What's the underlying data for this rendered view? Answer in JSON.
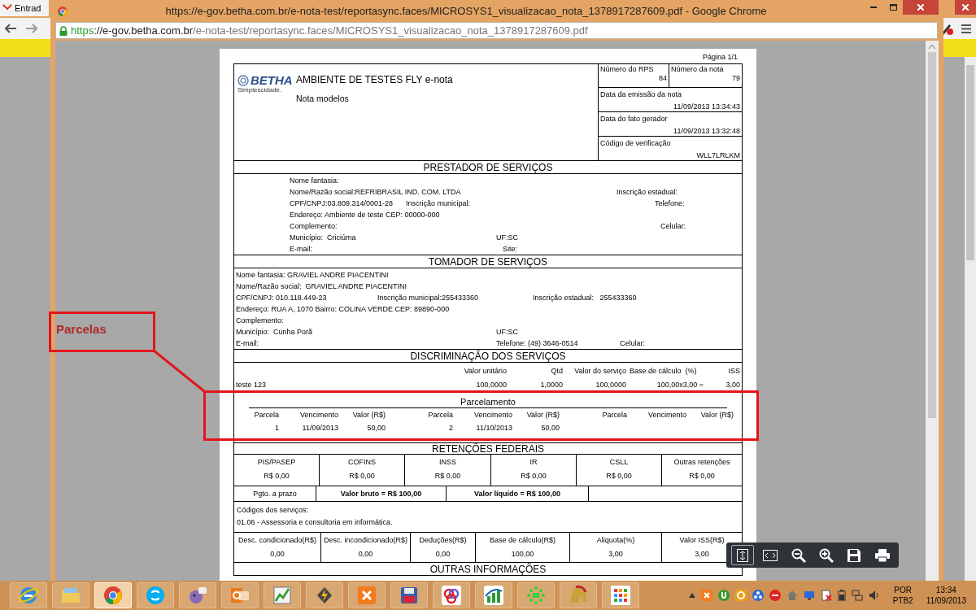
{
  "background_window": {
    "tab_title": "Entrad"
  },
  "window": {
    "title": "https://e-gov.betha.com.br/e-nota-test/reportasync.faces/MICROSYS1_visualizacao_nota_1378917287609.pdf - Google Chrome"
  },
  "address_bar": {
    "scheme": "https",
    "host": "://e-gov.betha.com.br",
    "path": "/e-nota-test/reportasync.faces/MICROSYS1_visualizacao_nota_1378917287609.pdf"
  },
  "document": {
    "page_label": "Página 1/1",
    "logo": {
      "brand": "BETHA",
      "tagline": "Simplescidade."
    },
    "title": "AMBIENTE DE TESTES FLY e-nota",
    "subtitle": "Nota modelos",
    "info": [
      {
        "label": "Número do RPS",
        "value": "84"
      },
      {
        "label": "Número da nota",
        "value": "79"
      },
      {
        "label": "Data da emissão da nota",
        "value": "11/09/2013 13:34:43"
      },
      {
        "label": "Data do fato gerador",
        "value": "11/09/2013 13:32:48"
      },
      {
        "label": "Código de verificação",
        "value": "WLL7LRLKM"
      }
    ],
    "sections": [
      {
        "title": "PRESTADOR DE SERVIÇOS",
        "rows": [
          [
            "Nome fantasia:"
          ],
          [
            "Nome/Razão social:REFRIBRASIL IND. COM. LTDA",
            "Inscrição estadual:"
          ],
          [
            "CPF/CNPJ:03.809.314/0001-28",
            "Inscrição municipal:",
            "Telefone:"
          ],
          [
            "Endereço: Ambiente de teste CEP: 00000-000"
          ],
          [
            "Complemento:",
            "Celular:"
          ],
          [
            "Município:  Criciúma",
            "UF:SC"
          ],
          [
            "E-mail:",
            "Site:"
          ]
        ]
      },
      {
        "title": "TOMADOR DE SERVIÇOS",
        "rows": [
          [
            "Nome fantasia: GRAVIEL ANDRE PIACENTINI"
          ],
          [
            "Nome/Razão social:  GRAVIEL ANDRE PIACENTINI"
          ],
          [
            "CPF/CNPJ: 010.118.449-23",
            "Inscrição municipal:255433360",
            "Inscrição estadual:   255433360"
          ],
          [
            "Endereço: RUA A, 1070 Bairro: COLINA VERDE CEP: 89890-000"
          ],
          [
            "Complemento:"
          ],
          [
            "Município:  Cunha Porã",
            "UF:SC"
          ],
          [
            "E-mail:",
            "Telefone: (49) 3646-0514",
            "Celular:"
          ]
        ]
      }
    ],
    "services": {
      "title": "DISCRIMINAÇÃO DOS SERVIÇOS",
      "columns": [
        "Valor unitário",
        "Qtd",
        "Valor do serviço",
        "Base de cálculo  (%)",
        "ISS"
      ],
      "rows": [
        {
          "description": "teste 123",
          "cells": [
            "100,0000",
            "1,0000",
            "100,0000",
            "100,00x3,00 =",
            "3,00"
          ]
        }
      ]
    },
    "installments": {
      "title": "Parcelamento",
      "groups": [
        [
          "Parcela",
          "Vencimento",
          "Valor (R$)"
        ],
        [
          "Parcela",
          "Vencimento",
          "Valor (R$)"
        ],
        [
          "Parcela",
          "Vencimento",
          "Valor (R$)"
        ]
      ],
      "entries": [
        [
          "1",
          "11/09/2013",
          "50,00"
        ],
        [
          "2",
          "11/10/2013",
          "50,00"
        ]
      ]
    },
    "federal_withholdings": {
      "title": "RETENÇÕES FEDERAIS",
      "items": [
        {
          "label": "PIS/PASEP",
          "value": "R$ 0,00"
        },
        {
          "label": "COFINS",
          "value": "R$ 0,00"
        },
        {
          "label": "INSS",
          "value": "R$ 0,00"
        },
        {
          "label": "IR",
          "value": "R$ 0,00"
        },
        {
          "label": "CSLL",
          "value": "R$ 0,00"
        },
        {
          "label": "Outras retenções",
          "value": "R$ 0,00"
        }
      ]
    },
    "totals": [
      {
        "text": "Pgto. a prazo",
        "bold": false
      },
      {
        "text": "Valor bruto = R$ 100,00",
        "bold": true
      },
      {
        "text": "Valor líquido = R$ 100,00",
        "bold": true
      }
    ],
    "service_codes": {
      "label": "Códigos dos serviços:",
      "text": "01.06 - Assessoria e consultoria em informática."
    },
    "deductions": [
      {
        "label": "Desc. condicionado(R$)",
        "value": "0,00"
      },
      {
        "label": "Desc. incondicionado(R$)",
        "value": "0,00"
      },
      {
        "label": "Deduções(R$)",
        "value": "0,00"
      },
      {
        "label": "Base de cálculo(R$)",
        "value": "100,00"
      },
      {
        "label": "Aliquota(%)",
        "value": "3,00"
      },
      {
        "label": "Valor ISS(R$)",
        "value": "3,00"
      }
    ],
    "next_section": "OUTRAS INFORMAÇÕES"
  },
  "annotation": {
    "label": "Parcelas"
  },
  "taskbar": {
    "apps": [
      {
        "selected": false
      },
      {
        "selected": false
      },
      {
        "selected": true
      },
      {
        "selected": false
      },
      {
        "selected": false
      },
      {
        "selected": false
      },
      {
        "selected": false
      },
      {
        "selected": false
      },
      {
        "selected": false
      },
      {
        "selected": false
      },
      {
        "selected": false
      },
      {
        "selected": false
      },
      {
        "selected": false
      },
      {
        "selected": false
      },
      {
        "selected": false
      }
    ],
    "language": "POR",
    "keyboard": "PTB2",
    "time": "13:34",
    "date": "11/09/2013"
  }
}
